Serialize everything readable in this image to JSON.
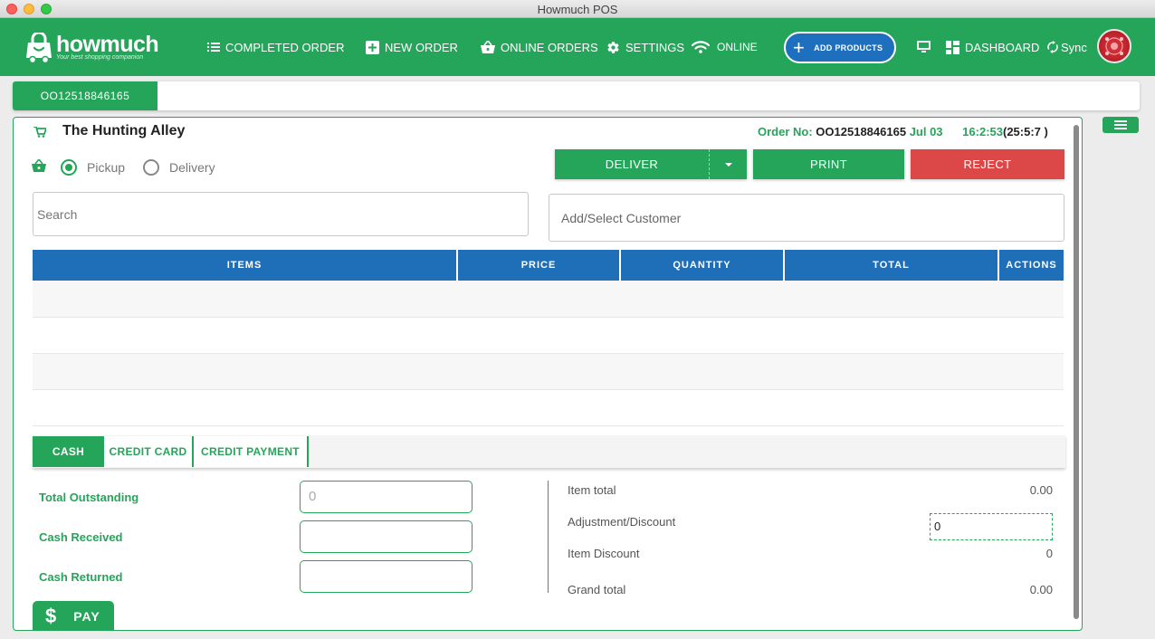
{
  "window": {
    "title": "Howmuch POS"
  },
  "nav": {
    "logo_text": "howmuch",
    "logo_tagline": "Your best shopping companion",
    "completed_order": "COMPLETED ORDER",
    "new_order": "NEW ORDER",
    "online_orders": "ONLINE ORDERS",
    "settings": "SETTINGS",
    "online": "ONLINE",
    "add_products": "ADD PRODUCTS",
    "dashboard": "DASHBOARD",
    "sync": "Sync"
  },
  "tabs": [
    {
      "label": "OO12518846165"
    }
  ],
  "order": {
    "store_name": "The Hunting Alley",
    "order_no_label": "Order No:",
    "order_no": "OO12518846165",
    "date": "Jul 03",
    "time": "16:2:53",
    "elapsed": "(25:5:7 )"
  },
  "fulfillment": {
    "pickup": "Pickup",
    "delivery": "Delivery",
    "selected": "Pickup"
  },
  "actions": {
    "deliver": "DELIVER",
    "print": "PRINT",
    "reject": "REJECT"
  },
  "search": {
    "placeholder": "Search"
  },
  "customer": {
    "placeholder": "Add/Select Customer"
  },
  "table": {
    "columns": [
      "ITEMS",
      "PRICE",
      "QUANTITY",
      "TOTAL",
      "ACTIONS"
    ],
    "rows": []
  },
  "payment_tabs": [
    "CASH",
    "CREDIT CARD",
    "CREDIT PAYMENT"
  ],
  "cash": {
    "total_outstanding_label": "Total Outstanding",
    "total_outstanding_placeholder": "0",
    "cash_received_label": "Cash Received",
    "cash_returned_label": "Cash Returned"
  },
  "summary": {
    "item_total_label": "Item total",
    "item_total": "0.00",
    "adjustment_label": "Adjustment/Discount",
    "adjustment_value": "0",
    "item_discount_label": "Item Discount",
    "item_discount": "0",
    "grand_total_label": "Grand total",
    "grand_total": "0.00"
  },
  "pay": {
    "label": "PAY"
  },
  "colors": {
    "primary": "#25a55a",
    "blue": "#1e6eb8",
    "reject": "#dc4848"
  }
}
